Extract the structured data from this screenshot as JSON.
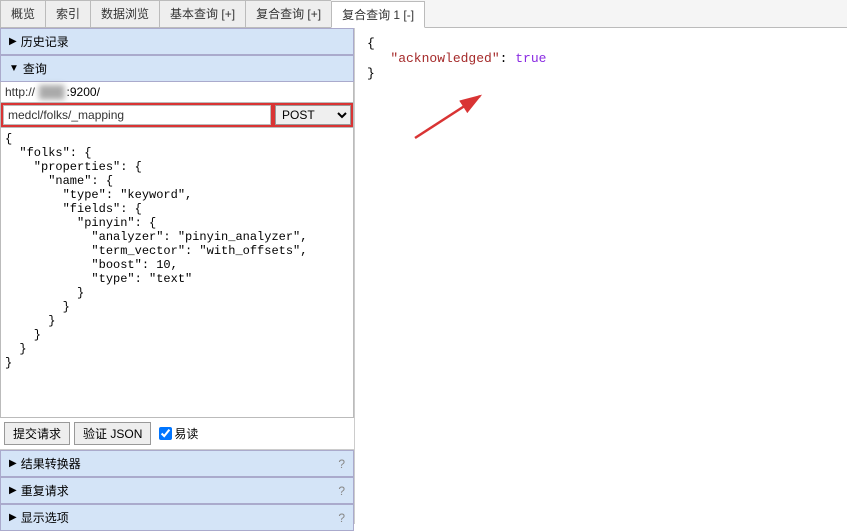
{
  "tabs": {
    "t0": "概览",
    "t1": "索引",
    "t2": "数据浏览",
    "t3": "基本查询 [+]",
    "t4": "复合查询 [+]",
    "t5": "复合查询 1 [-]"
  },
  "sections": {
    "history": "历史记录",
    "query": "查询",
    "result_transform": "结果转换器",
    "repeat_request": "重复请求",
    "display_options": "显示选项"
  },
  "url": {
    "prefix": "http://",
    "host_masked": "███",
    "port": ":9200/"
  },
  "request": {
    "path": "medcl/folks/_mapping",
    "method": "POST",
    "body": "{\n  \"folks\": {\n    \"properties\": {\n      \"name\": {\n        \"type\": \"keyword\",\n        \"fields\": {\n          \"pinyin\": {\n            \"analyzer\": \"pinyin_analyzer\",\n            \"term_vector\": \"with_offsets\",\n            \"boost\": 10,\n            \"type\": \"text\"\n          }\n        }\n      }\n    }\n  }\n}"
  },
  "buttons": {
    "submit": "提交请求",
    "validate": "验证 JSON",
    "pretty": "易读"
  },
  "response": {
    "open": "{",
    "key": "\"acknowledged\"",
    "colon": ": ",
    "value": "true",
    "close": "}"
  },
  "help": "?"
}
